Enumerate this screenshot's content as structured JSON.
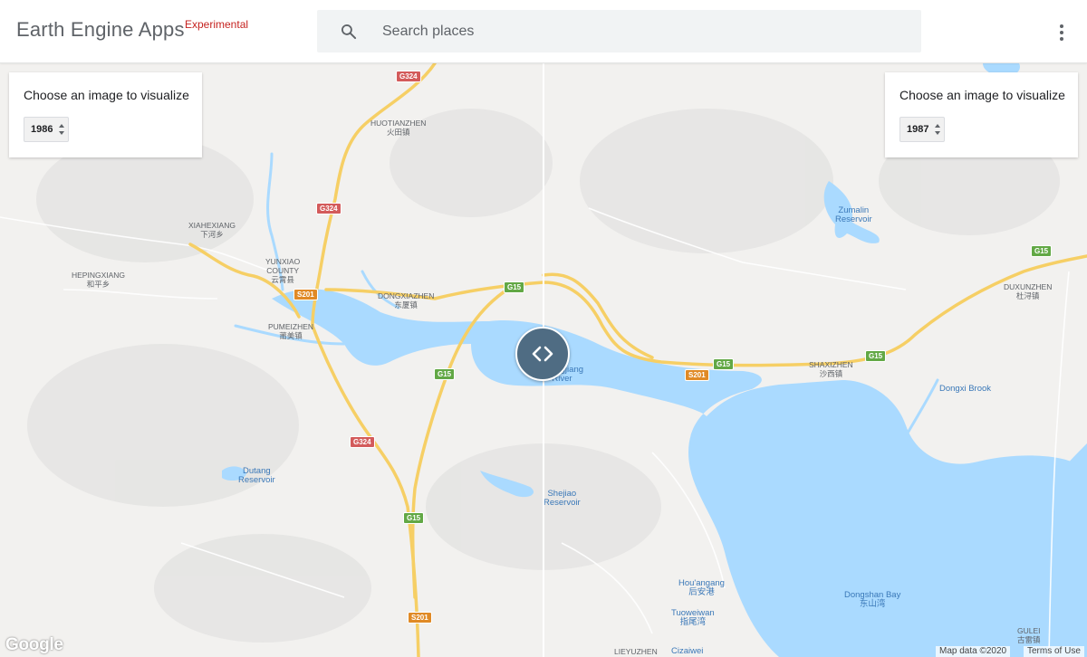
{
  "header": {
    "brand": "Earth Engine Apps",
    "badge": "Experimental",
    "search_placeholder": "Search places",
    "icons": {
      "search": "search-icon",
      "more": "more-vert-icon"
    }
  },
  "left_panel": {
    "title": "Choose an image to visualize",
    "selected_year": "1986"
  },
  "right_panel": {
    "title": "Choose an image to visualize",
    "selected_year": "1987"
  },
  "split_handle": {
    "icon": "code-chevrons-icon"
  },
  "map": {
    "places": {
      "huotianzhen": {
        "name": "HUOTIANZHEN",
        "local": "火田镇"
      },
      "xiahexiang": {
        "name": "XIAHEXIANG",
        "local": "下河乡"
      },
      "hepingxiang": {
        "name": "HEPINGXIANG",
        "local": "和平乡"
      },
      "yunxiao": {
        "name": "YUNXIAO",
        "name2": "COUNTY",
        "local": "云霄县"
      },
      "pumeizhen": {
        "name": "PUMEIZHEN",
        "local": "莆美镇"
      },
      "dongxiazhen": {
        "name": "DONGXIAZHEN",
        "local": "东厦镇"
      },
      "shaxizhen": {
        "name": "SHAXIZHEN",
        "local": "沙西镇"
      },
      "duxunzhen": {
        "name": "DUXUNZHEN",
        "local": "杜浔镇"
      },
      "liuyuzhen": {
        "name": "LIEYUZHEN"
      },
      "cizaiwei": {
        "name": "Cizaiwei"
      },
      "guilei": {
        "name": "GULEI",
        "local": "古雷镇"
      }
    },
    "water": {
      "zumalin": {
        "name": "Zumalin",
        "name2": "Reservoir"
      },
      "zhangjiang": {
        "name": "Zhangjiang",
        "name2": "River"
      },
      "dongxi": {
        "name": "Dongxi Brook"
      },
      "dutang": {
        "name": "Dutang",
        "name2": "Reservoir"
      },
      "shejiao": {
        "name": "Shejiao",
        "name2": "Reservoir"
      },
      "houangang": {
        "name": "Hou'angang",
        "local": "后安港"
      },
      "tuoweiwan": {
        "name": "Tuoweiwan",
        "local": "指尾湾"
      },
      "dongshan": {
        "name": "Dongshan Bay",
        "local": "东山湾"
      }
    },
    "shields": {
      "g324_a": "G324",
      "g324_b": "G324",
      "g324_c": "G324",
      "s201_a": "S201",
      "s201_b": "S201",
      "s201_c": "S201",
      "g15_a": "G15",
      "g15_b": "G15",
      "g15_c": "G15",
      "g15_d": "G15",
      "g15_e": "G15",
      "g15_f": "G15"
    },
    "colors": {
      "land": "#f2f1ef",
      "water": "#aadaff",
      "road": "#f6cf65",
      "split": "#ffffff",
      "handle": "#4f6c83"
    }
  },
  "footer": {
    "logo": "Google",
    "map_data": "Map data ©2020",
    "terms": "Terms of Use"
  }
}
